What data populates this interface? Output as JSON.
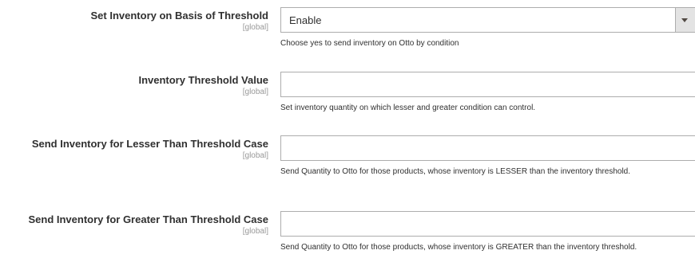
{
  "fields": [
    {
      "label": "Set Inventory on Basis of Threshold",
      "scope": "[global]",
      "type": "select",
      "value": "Enable",
      "note": "Choose yes to send inventory on Otto by condition"
    },
    {
      "label": "Inventory Threshold Value",
      "scope": "[global]",
      "type": "text",
      "value": "",
      "note": "Set inventory quantity on which lesser and greater condition can control."
    },
    {
      "label": "Send Inventory for Lesser Than Threshold Case",
      "scope": "[global]",
      "type": "text",
      "value": "",
      "note": "Send Quantity to Otto for those products, whose inventory is LESSER than the inventory threshold."
    },
    {
      "label": "Send Inventory for Greater Than Threshold Case",
      "scope": "[global]",
      "type": "text",
      "value": "",
      "note": "Send Quantity to Otto for those products, whose inventory is GREATER than the inventory threshold."
    }
  ],
  "icons": {
    "dropdown": "chevron-down-icon"
  },
  "colors": {
    "text": "#303030",
    "scope": "#999999",
    "border": "#adadad",
    "select_button": "#e3e3e3"
  }
}
